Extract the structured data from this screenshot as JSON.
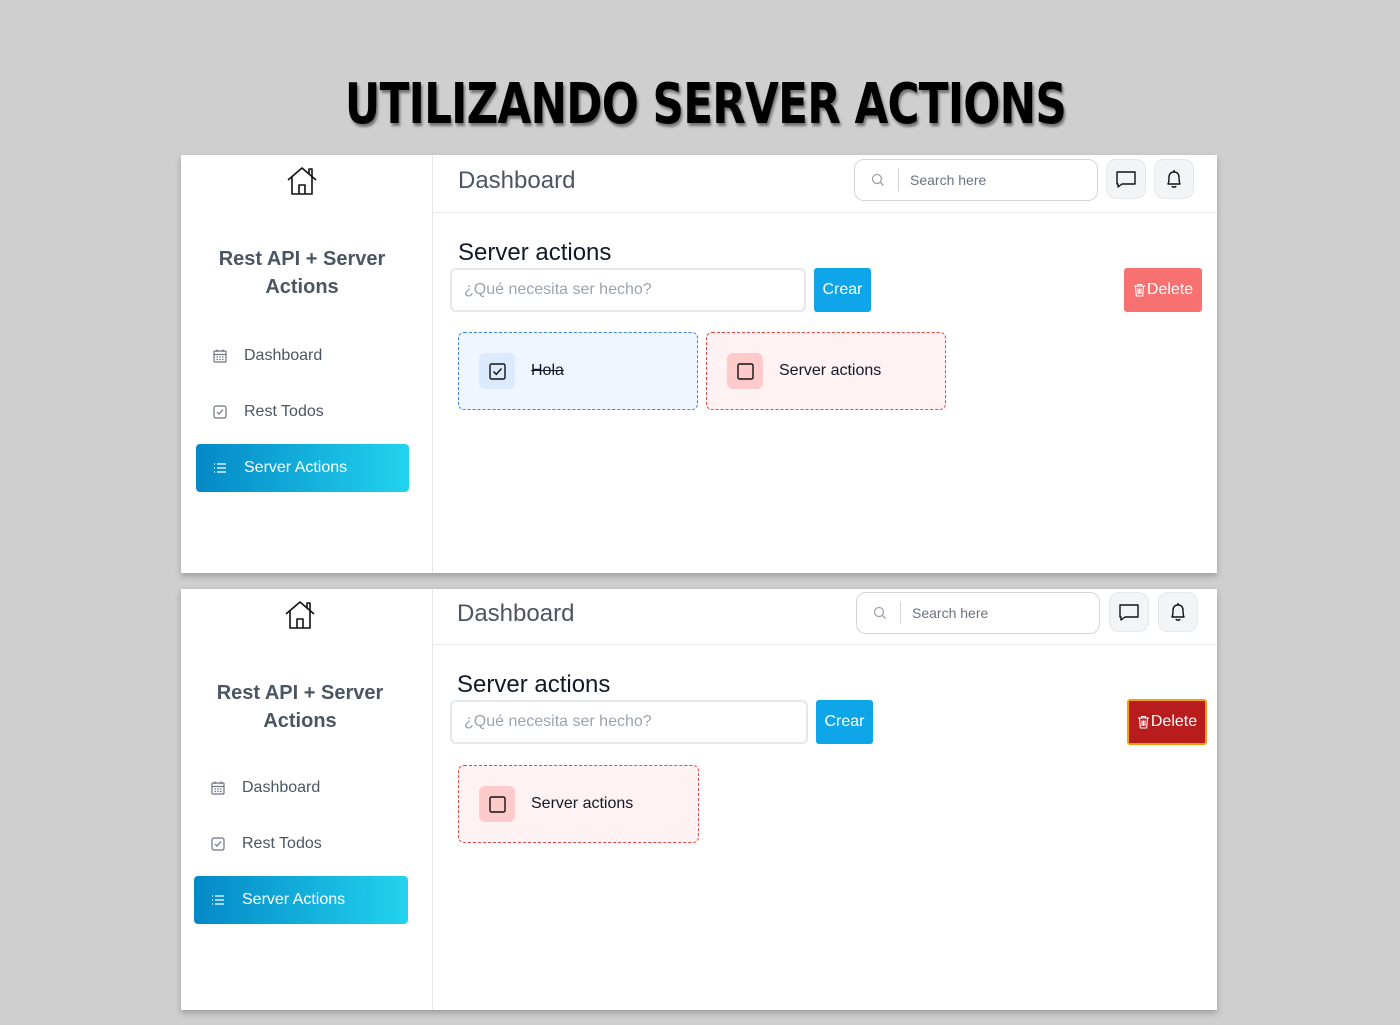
{
  "banner": {
    "title": "UTILIZANDO SERVER ACTIONS"
  },
  "screens": [
    {
      "sidebar": {
        "brand": "Rest API + Server Actions",
        "items": [
          {
            "label": "Dashboard",
            "icon": "calendar-icon",
            "active": false
          },
          {
            "label": "Rest Todos",
            "icon": "checkbox-icon",
            "active": false
          },
          {
            "label": "Server Actions",
            "icon": "list-icon",
            "active": true
          }
        ]
      },
      "header": {
        "title": "Dashboard",
        "search_placeholder": "Search here"
      },
      "main": {
        "section_title": "Server actions",
        "input_placeholder": "¿Qué necesita ser hecho?",
        "create_label": "Crear",
        "delete_label": "Delete",
        "delete_state": "normal",
        "todos": [
          {
            "text": "Hola",
            "complete": true
          },
          {
            "text": "Server actions",
            "complete": false
          }
        ]
      }
    },
    {
      "sidebar": {
        "brand": "Rest API + Server Actions",
        "items": [
          {
            "label": "Dashboard",
            "icon": "calendar-icon",
            "active": false
          },
          {
            "label": "Rest Todos",
            "icon": "checkbox-icon",
            "active": false
          },
          {
            "label": "Server Actions",
            "icon": "list-icon",
            "active": true
          }
        ]
      },
      "header": {
        "title": "Dashboard",
        "search_placeholder": "Search here"
      },
      "main": {
        "section_title": "Server actions",
        "input_placeholder": "¿Qué necesita ser hecho?",
        "create_label": "Crear",
        "delete_label": "Delete",
        "delete_state": "focused",
        "todos": [
          {
            "text": "Server actions",
            "complete": false
          }
        ]
      }
    }
  ],
  "colors": {
    "accent_start": "#0488c7",
    "accent_end": "#22d3ee",
    "create_button": "#0ea5e9",
    "delete_button": "#f87171",
    "delete_button_focused": "#b91c1c",
    "done_card_border": "#3b82f6",
    "pending_card_border": "#ef4444"
  }
}
